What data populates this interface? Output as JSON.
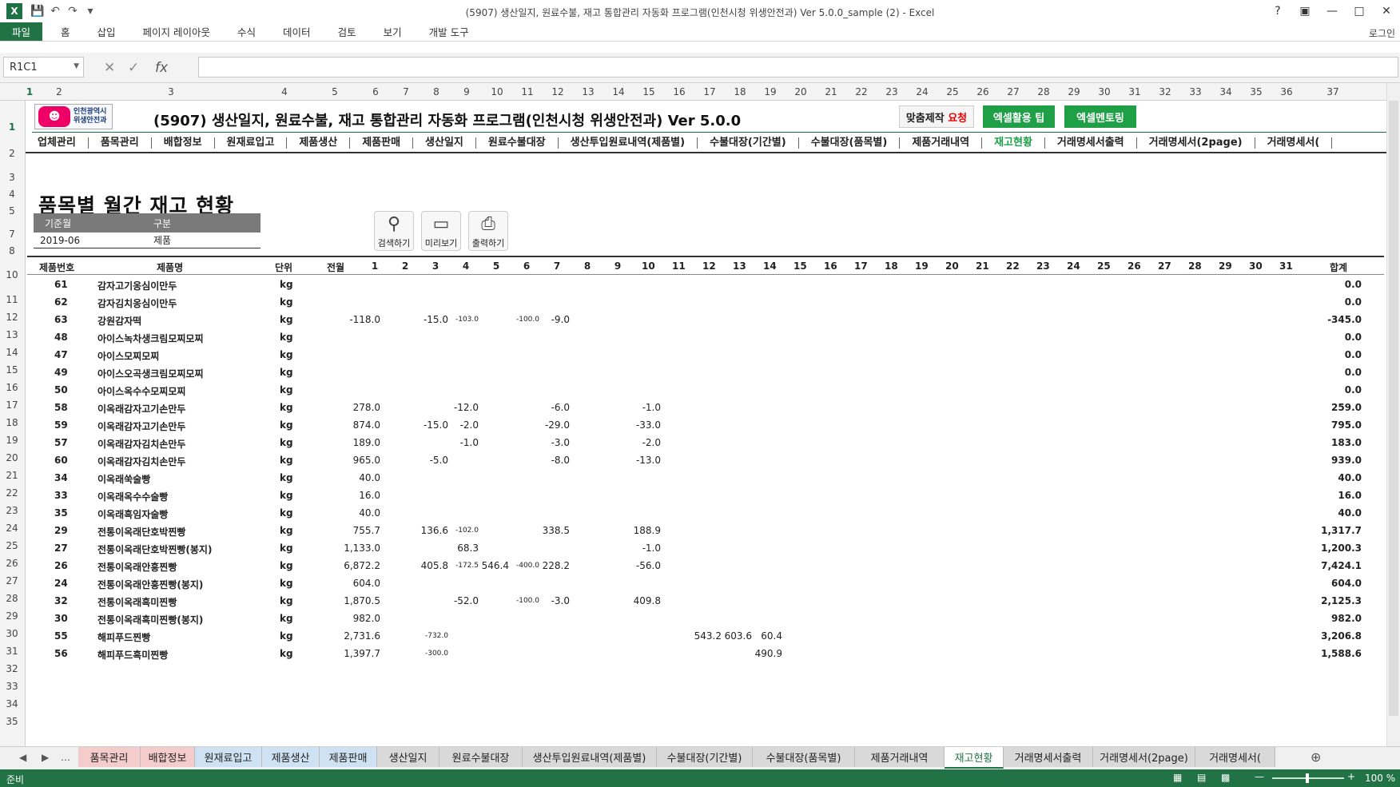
{
  "window": {
    "title": "(5907) 생산일지, 원료수불, 재고 통합관리 자동화 프로그램(인천시청 위생안전과) Ver 5.0.0_sample (2) - Excel",
    "app_icon": "excel-icon",
    "login": "로그인"
  },
  "ribbon": {
    "tabs": [
      "파일",
      "홈",
      "삽입",
      "페이지 레이아웃",
      "수식",
      "데이터",
      "검토",
      "보기",
      "개발 도구"
    ]
  },
  "formula_bar": {
    "name_box": "R1C1",
    "formula": ""
  },
  "columns": [
    "1",
    "2",
    "3",
    "4",
    "5",
    "6",
    "7",
    "8",
    "9",
    "10",
    "11",
    "12",
    "13",
    "14",
    "15",
    "16",
    "17",
    "18",
    "19",
    "20",
    "21",
    "22",
    "23",
    "24",
    "25",
    "26",
    "27",
    "28",
    "29",
    "30",
    "31",
    "32",
    "33",
    "34",
    "35",
    "36",
    "37"
  ],
  "rows": [
    "1",
    "2",
    "3",
    "4",
    "5",
    "7",
    "8",
    "10",
    "11",
    "12",
    "13",
    "14",
    "15",
    "16",
    "17",
    "18",
    "19",
    "20",
    "21",
    "22",
    "23",
    "24",
    "25",
    "26",
    "27",
    "28",
    "29",
    "30",
    "31",
    "32",
    "33",
    "34",
    "35"
  ],
  "banner": {
    "logo_line1": "인천광역시",
    "logo_line2": "위생안전과",
    "title": "(5907) 생산일지, 원료수불, 재고 통합관리 자동화 프로그램(인천시청 위생안전과) Ver 5.0.0",
    "req_a": "맞춤제작",
    "req_b": "요청",
    "btn_tip": "엑셀활용 팁",
    "btn_mentor": "엑셀멘토링"
  },
  "nav": [
    "업체관리",
    "품목관리",
    "배합정보",
    "원재료입고",
    "제품생산",
    "제품판매",
    "생산일지",
    "원료수불대장",
    "생산투입원료내역(제품별)",
    "수불대장(기간별)",
    "수불대장(품목별)",
    "제품거래내역",
    "재고현황",
    "거래명세서출력",
    "거래명세서(2page)",
    "거래명세서("
  ],
  "page_title": "품목별 월간 재고 현황",
  "filter": {
    "h_month": "기준월",
    "h_type": "구분",
    "month": "2019-06",
    "type": "제품"
  },
  "tools": {
    "search": "검색하기",
    "preview": "미리보기",
    "print": "출력하기"
  },
  "table": {
    "headers": {
      "no": "제품번호",
      "name": "제품명",
      "unit": "단위",
      "prev": "전월",
      "total": "합계"
    },
    "days": [
      "1",
      "2",
      "3",
      "4",
      "5",
      "6",
      "7",
      "8",
      "9",
      "10",
      "11",
      "12",
      "13",
      "14",
      "15",
      "16",
      "17",
      "18",
      "19",
      "20",
      "21",
      "22",
      "23",
      "24",
      "25",
      "26",
      "27",
      "28",
      "29",
      "30",
      "31"
    ],
    "rows": [
      {
        "no": "61",
        "name": "감자고기옹심이만두",
        "unit": "kg",
        "prev": "",
        "cells": {},
        "total": "0.0"
      },
      {
        "no": "62",
        "name": "감자김치옹심이만두",
        "unit": "kg",
        "prev": "",
        "cells": {},
        "total": "0.0"
      },
      {
        "no": "63",
        "name": "강원감자떡",
        "unit": "kg",
        "prev": "-118.0",
        "cells": {
          "3": "-15.0",
          "4": "-103.0",
          "6": "-100.0",
          "7": "-9.0"
        },
        "total": "-345.0"
      },
      {
        "no": "48",
        "name": "아이스녹차생크림모찌모찌",
        "unit": "kg",
        "prev": "",
        "cells": {},
        "total": "0.0"
      },
      {
        "no": "47",
        "name": "아이스모찌모찌",
        "unit": "kg",
        "prev": "",
        "cells": {},
        "total": "0.0"
      },
      {
        "no": "49",
        "name": "아이스오곡생크림모찌모찌",
        "unit": "kg",
        "prev": "",
        "cells": {},
        "total": "0.0"
      },
      {
        "no": "50",
        "name": "아이스옥수수모찌모찌",
        "unit": "kg",
        "prev": "",
        "cells": {},
        "total": "0.0"
      },
      {
        "no": "58",
        "name": "이옥래감자고기손만두",
        "unit": "kg",
        "prev": "278.0",
        "cells": {
          "4": "-12.0",
          "7": "-6.0",
          "10": "-1.0"
        },
        "total": "259.0"
      },
      {
        "no": "59",
        "name": "이옥래감자고기손만두",
        "unit": "kg",
        "prev": "874.0",
        "cells": {
          "3": "-15.0",
          "4": "-2.0",
          "7": "-29.0",
          "10": "-33.0"
        },
        "total": "795.0"
      },
      {
        "no": "57",
        "name": "이옥래감자김치손만두",
        "unit": "kg",
        "prev": "189.0",
        "cells": {
          "4": "-1.0",
          "7": "-3.0",
          "10": "-2.0"
        },
        "total": "183.0"
      },
      {
        "no": "60",
        "name": "이옥래감자김치손만두",
        "unit": "kg",
        "prev": "965.0",
        "cells": {
          "3": "-5.0",
          "7": "-8.0",
          "10": "-13.0"
        },
        "total": "939.0"
      },
      {
        "no": "34",
        "name": "이옥래쑥술빵",
        "unit": "kg",
        "prev": "40.0",
        "cells": {},
        "total": "40.0"
      },
      {
        "no": "33",
        "name": "이옥래옥수수술빵",
        "unit": "kg",
        "prev": "16.0",
        "cells": {},
        "total": "16.0"
      },
      {
        "no": "35",
        "name": "이옥래흑임자술빵",
        "unit": "kg",
        "prev": "40.0",
        "cells": {},
        "total": "40.0"
      },
      {
        "no": "29",
        "name": "전통이옥래단호박찐빵",
        "unit": "kg",
        "prev": "755.7",
        "cells": {
          "3": "136.6",
          "4": "-102.0",
          "7": "338.5",
          "10": "188.9"
        },
        "total": "1,317.7"
      },
      {
        "no": "27",
        "name": "전통이옥래단호박찐빵(봉지)",
        "unit": "kg",
        "prev": "1,133.0",
        "cells": {
          "4": "68.3",
          "10": "-1.0"
        },
        "total": "1,200.3"
      },
      {
        "no": "26",
        "name": "전통이옥래안흥찐빵",
        "unit": "kg",
        "prev": "6,872.2",
        "cells": {
          "3": "405.8",
          "4": "-172.5",
          "5": "546.4",
          "6": "-400.0",
          "7": "228.2",
          "10": "-56.0"
        },
        "total": "7,424.1"
      },
      {
        "no": "24",
        "name": "전통이옥래안흥찐빵(봉지)",
        "unit": "kg",
        "prev": "604.0",
        "cells": {},
        "total": "604.0"
      },
      {
        "no": "32",
        "name": "전통이옥래흑미찐빵",
        "unit": "kg",
        "prev": "1,870.5",
        "cells": {
          "4": "-52.0",
          "6": "-100.0",
          "7": "-3.0",
          "10": "409.8"
        },
        "total": "2,125.3"
      },
      {
        "no": "30",
        "name": "전통이옥래흑미찐빵(봉지)",
        "unit": "kg",
        "prev": "982.0",
        "cells": {},
        "total": "982.0"
      },
      {
        "no": "55",
        "name": "해피푸드찐빵",
        "unit": "kg",
        "prev": "2,731.6",
        "cells": {
          "3": "-732.0",
          "12": "543.2",
          "13": "603.6",
          "14": "60.4"
        },
        "total": "3,206.8"
      },
      {
        "no": "56",
        "name": "해피푸드흑미찐빵",
        "unit": "kg",
        "prev": "1,397.7",
        "cells": {
          "3": "-300.0",
          "14": "490.9"
        },
        "total": "1,588.6"
      }
    ]
  },
  "sheet_tabs": [
    "품목관리",
    "배합정보",
    "원재료입고",
    "제품생산",
    "제품판매",
    "생산일지",
    "원료수불대장",
    "생산투입원료내역(제품별)",
    "수불대장(기간별)",
    "수불대장(품목별)",
    "제품거래내역",
    "재고현황",
    "거래명세서출력",
    "거래명세서(2page)",
    "거래명세서("
  ],
  "sheet_tab_colors": [
    "#f4cccc",
    "#f4cccc",
    "#cfe2f3",
    "#cfe2f3",
    "#cfe2f3",
    "#d9d9d9",
    "#d9d9d9",
    "#d9d9d9",
    "#d9d9d9",
    "#d9d9d9",
    "#d9d9d9",
    "#ffffff",
    "#d9d9d9",
    "#d9d9d9",
    "#d9d9d9"
  ],
  "active_sheet": "재고현황",
  "status": {
    "ready": "준비",
    "zoom": "100 %"
  },
  "colors": {
    "excel_green": "#217346",
    "accent_green": "#1fa046",
    "red": "#e00000"
  }
}
